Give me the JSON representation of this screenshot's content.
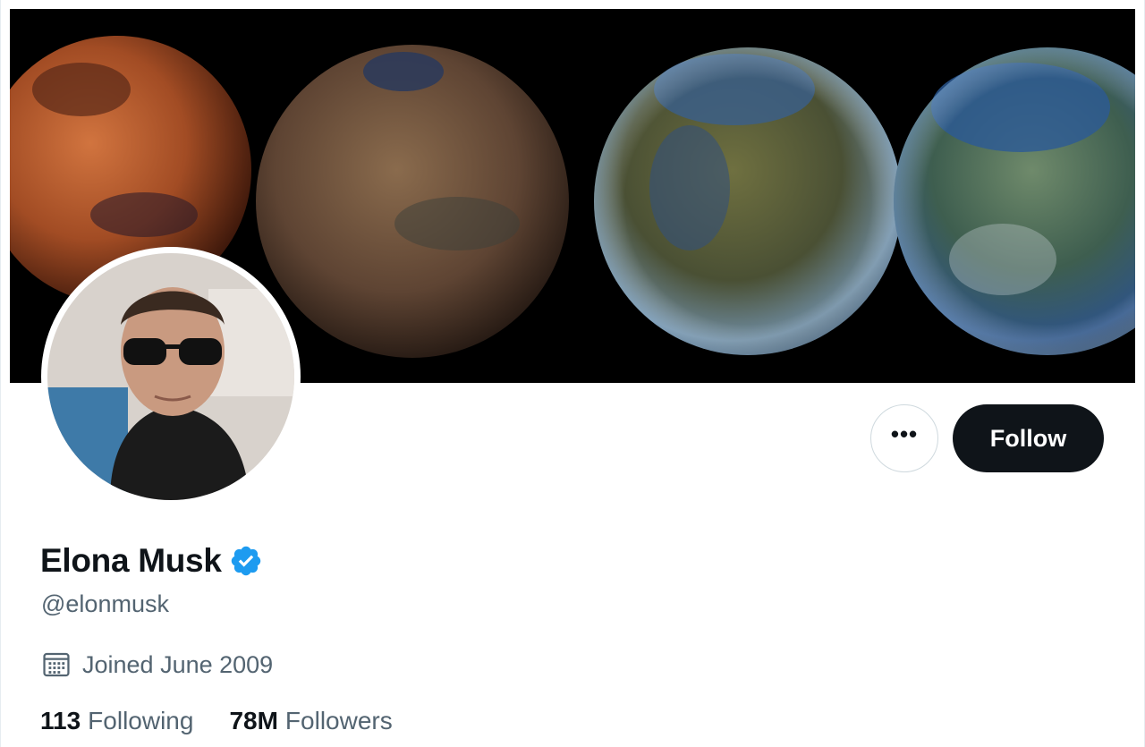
{
  "profile": {
    "display_name": "Elona Musk",
    "handle": "@elonmusk",
    "joined": "Joined June 2009",
    "following_count": "113",
    "following_label": "Following",
    "followers_count": "78M",
    "followers_label": "Followers",
    "verified": true
  },
  "actions": {
    "more_label": "•••",
    "follow_label": "Follow"
  },
  "icons": {
    "more": "more-horizontal-icon",
    "verified": "verified-badge-icon",
    "calendar": "calendar-icon"
  },
  "colors": {
    "follow_bg": "#0f1419",
    "verified_blue": "#1d9bf0",
    "secondary_text": "#536471"
  }
}
